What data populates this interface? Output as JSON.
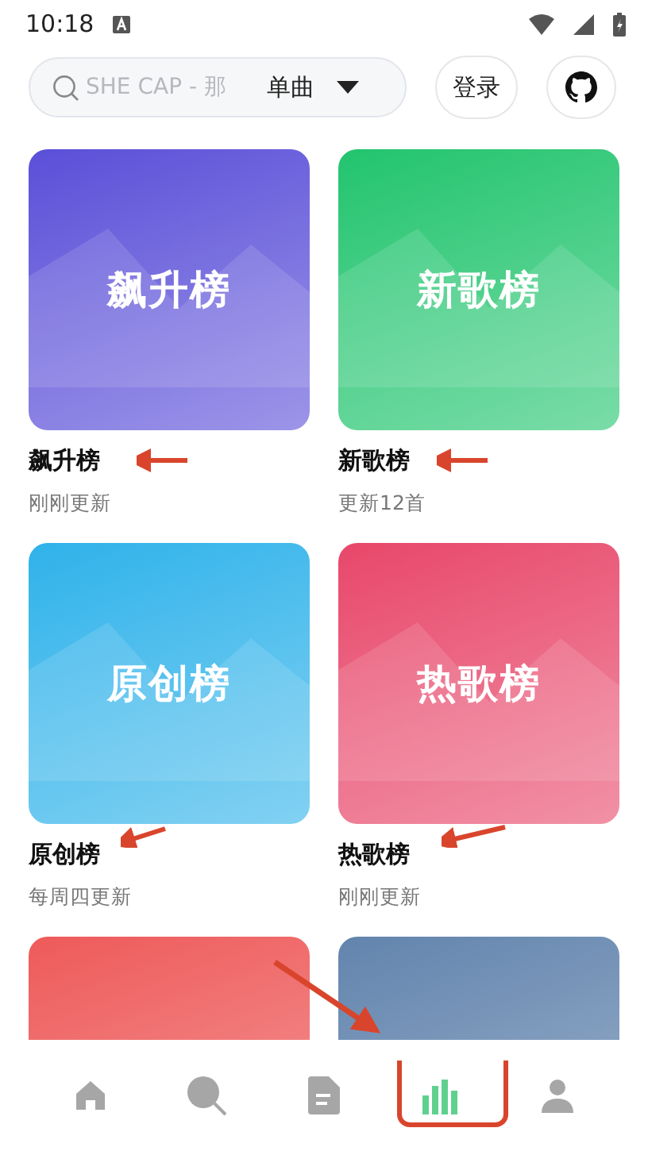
{
  "status_bar": {
    "time": "10:18"
  },
  "search": {
    "placeholder": "SHE CAP - 那",
    "type_select": "单曲"
  },
  "login_button": "登录",
  "charts": [
    {
      "cover_title": "飙升榜",
      "title": "飙升榜",
      "subtitle": "刚刚更新",
      "color": "#5a4fd8"
    },
    {
      "cover_title": "新歌榜",
      "title": "新歌榜",
      "subtitle": "更新12首",
      "color": "#22c46e"
    },
    {
      "cover_title": "原创榜",
      "title": "原创榜",
      "subtitle": "每周四更新",
      "color": "#2fb2ea"
    },
    {
      "cover_title": "热歌榜",
      "title": "热歌榜",
      "subtitle": "刚刚更新",
      "color": "#e8476a"
    },
    {
      "color": "#ee5a5a"
    },
    {
      "color": "#6284ad"
    }
  ],
  "nav": [
    {
      "kind": "home",
      "selected": false
    },
    {
      "kind": "search",
      "selected": false
    },
    {
      "kind": "document",
      "selected": false
    },
    {
      "kind": "chart",
      "selected": true
    },
    {
      "kind": "profile",
      "selected": false
    }
  ]
}
